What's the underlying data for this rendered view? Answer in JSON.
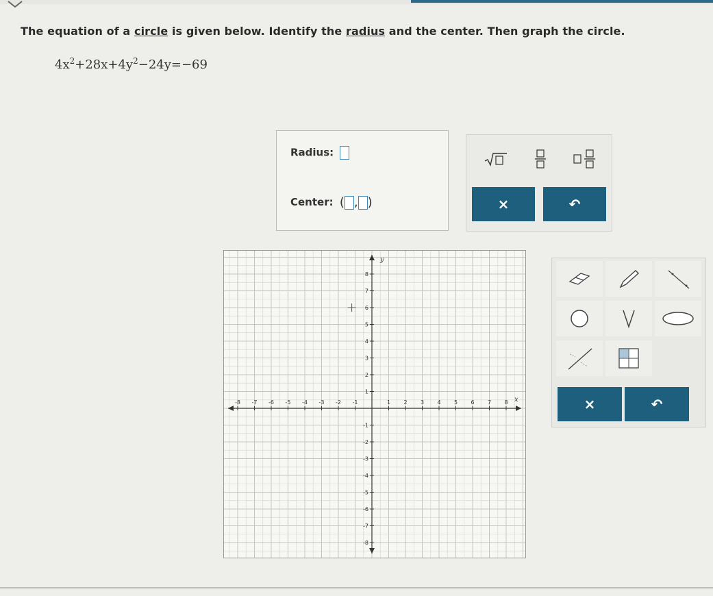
{
  "question": {
    "part1": "The equation of a ",
    "link1": "circle",
    "part2": " is given below. Identify the ",
    "link2": "radius",
    "part3": " and the center. Then graph the circle."
  },
  "equation": {
    "t1": "4x",
    "e1": "2",
    "t2": "+28x+4y",
    "e2": "2",
    "t3": "−24y=−69"
  },
  "answer": {
    "radius_label": "Radius:",
    "center_label": "Center:",
    "open_paren": "(",
    "comma": ",",
    "close_paren": ")"
  },
  "keypad": {
    "clear_symbol": "×",
    "undo_symbol": "↶"
  },
  "graph": {
    "x_label": "x",
    "y_label": "y",
    "x_ticks": [
      "-8",
      "-7",
      "-6",
      "-5",
      "-4",
      "-3",
      "-2",
      "-1",
      "1",
      "2",
      "3",
      "4",
      "5",
      "6",
      "7",
      "8"
    ],
    "y_ticks": [
      "8",
      "7",
      "6",
      "5",
      "4",
      "3",
      "2",
      "1",
      "-1",
      "-2",
      "-3",
      "-4",
      "-5",
      "-6",
      "-7",
      "-8"
    ]
  },
  "tools": {
    "clear_symbol": "×",
    "undo_symbol": "↶"
  },
  "colors": {
    "accent": "#1e5f7e",
    "slot_border": "#3d87b7"
  }
}
